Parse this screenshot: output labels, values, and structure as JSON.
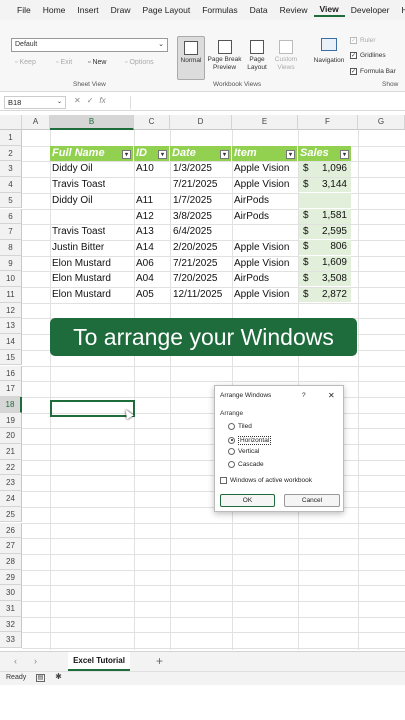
{
  "menu": [
    "File",
    "Home",
    "Insert",
    "Draw",
    "Page Layout",
    "Formulas",
    "Data",
    "Review",
    "View",
    "Developer",
    "Help"
  ],
  "menu_active": "View",
  "sheet_view": {
    "dropdown_value": "Default",
    "keep": "Keep",
    "exit": "Exit",
    "new": "New",
    "options": "Options",
    "group_label": "Sheet View"
  },
  "workbook_views": {
    "normal": "Normal",
    "page_break_1": "Page Break",
    "page_break_2": "Preview",
    "page_layout_1": "Page",
    "page_layout_2": "Layout",
    "custom_1": "Custom",
    "custom_2": "Views",
    "group_label": "Workbook Views"
  },
  "navigation_label": "Navigation",
  "show": {
    "ruler": "Ruler",
    "gridlines": "Gridlines",
    "formula_bar": "Formula Bar",
    "group_label": "Show"
  },
  "name_box": "B18",
  "fx_icons": {
    "cancel": "✕",
    "enter": "✓",
    "fx": "fx"
  },
  "columns": [
    "A",
    "B",
    "C",
    "D",
    "E",
    "F",
    "G"
  ],
  "selected_column": "B",
  "rows": [
    "1",
    "2",
    "3",
    "4",
    "5",
    "6",
    "7",
    "8",
    "9",
    "10",
    "11",
    "12",
    "13",
    "14",
    "15",
    "16",
    "17",
    "18",
    "19",
    "20",
    "21",
    "22",
    "23",
    "24",
    "25",
    "26",
    "27",
    "28",
    "29",
    "30",
    "31",
    "32",
    "33"
  ],
  "selected_row": "18",
  "table": {
    "headers": [
      "Full Name",
      "ID",
      "Date",
      "Item",
      "Sales"
    ],
    "rows": [
      [
        "Diddy Oil",
        "A10",
        "1/3/2025",
        "Apple Vision",
        "$",
        "1,096"
      ],
      [
        "Travis Toast",
        "",
        "7/21/2025",
        "Apple Vision",
        "$",
        "3,144"
      ],
      [
        "Diddy Oil",
        "A11",
        "1/7/2025",
        "AirPods",
        "",
        ""
      ],
      [
        "",
        "A12",
        "3/8/2025",
        "AirPods",
        "$",
        "1,581"
      ],
      [
        "Travis Toast",
        "A13",
        "6/4/2025",
        "",
        "$",
        "2,595"
      ],
      [
        "Justin Bitter",
        "A14",
        "2/20/2025",
        "Apple Vision",
        "$",
        "806"
      ],
      [
        "Elon Mustard",
        "A06",
        "7/21/2025",
        "Apple Vision",
        "$",
        "1,609"
      ],
      [
        "Elon Mustard",
        "A04",
        "7/20/2025",
        "AirPods",
        "$",
        "3,508"
      ],
      [
        "Elon Mustard",
        "A05",
        "12/11/2025",
        "Apple Vision",
        "$",
        "2,872"
      ]
    ]
  },
  "banner": "To arrange your Windows",
  "dialog": {
    "title": "Arrange Windows",
    "help": "?",
    "close": "✕",
    "group": "Arrange",
    "options": [
      "Tiled",
      "Horizontal",
      "Vertical",
      "Cascade"
    ],
    "selected_option": "Horizontal",
    "checkbox_label": "Windows of active workbook",
    "ok": "OK",
    "cancel": "Cancel"
  },
  "sheet_tab": "Excel Tutorial",
  "status": "Ready",
  "colors": {
    "accent": "#1e6b3c",
    "header_fill": "#92d050",
    "sales_fill": "#e2efda"
  }
}
